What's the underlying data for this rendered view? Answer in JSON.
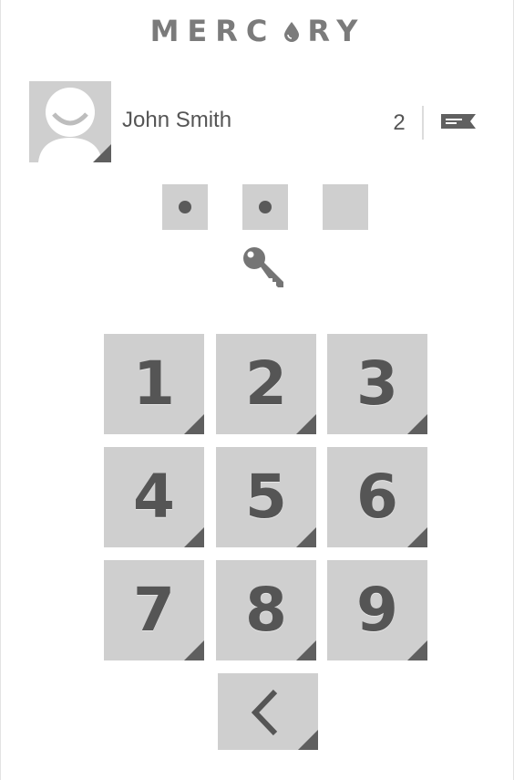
{
  "app": {
    "logo_text": "MERCURY",
    "logo_before": "MERC",
    "logo_drop_letter": "U",
    "logo_after": "RY"
  },
  "user": {
    "name": "John Smith",
    "message_count": "2"
  },
  "pin": {
    "entered_digits": 2,
    "length": 3
  },
  "keypad": {
    "keys": [
      "1",
      "2",
      "3",
      "4",
      "5",
      "6",
      "7",
      "8",
      "9"
    ]
  },
  "icons": {
    "avatar": "avatar-placeholder-icon",
    "messages": "message-icon",
    "key": "key-icon",
    "back": "back-arrow-icon",
    "logo_drop": "water-drop-icon"
  },
  "colors": {
    "tile": "#cfcfcf",
    "text": "#555555",
    "logo": "#7b7b7b",
    "accent_corner": "#5f5f5f",
    "background": "#ffffff"
  }
}
